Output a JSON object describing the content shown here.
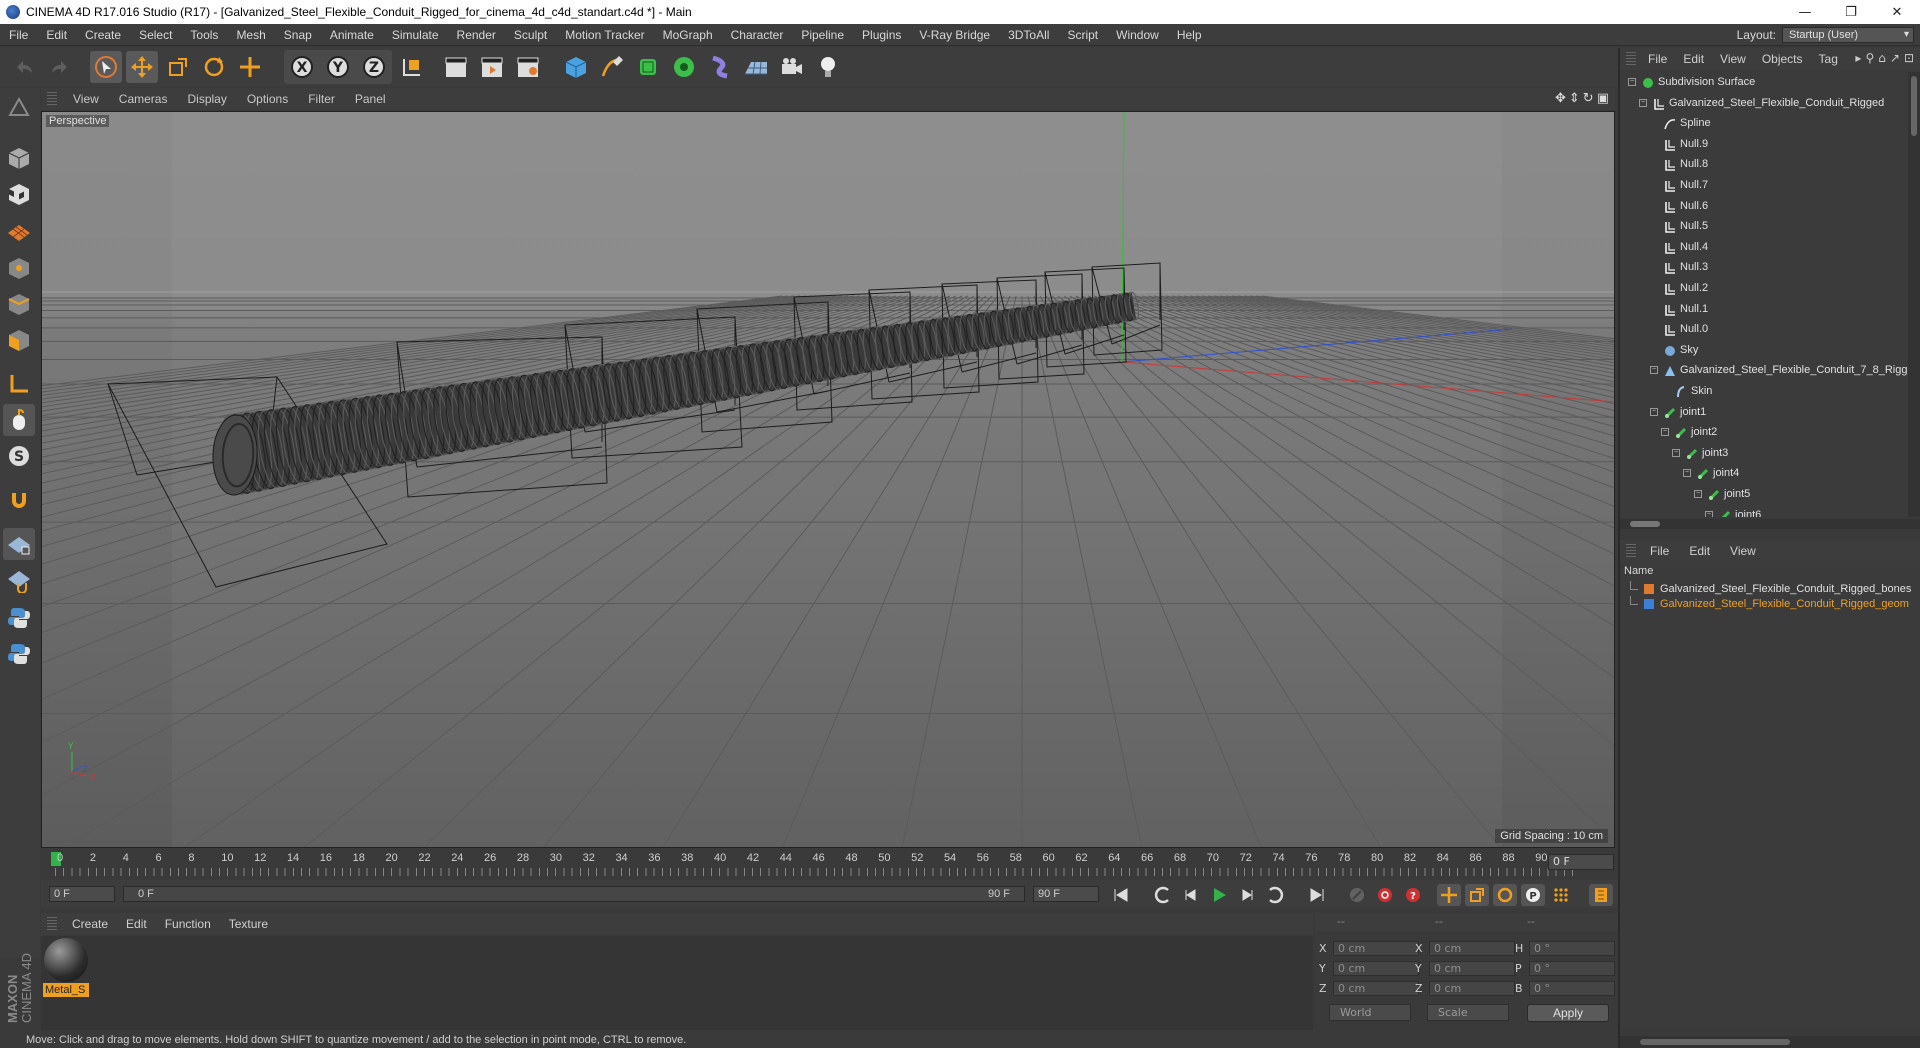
{
  "titlebar": {
    "title": "CINEMA 4D R17.016 Studio (R17) - [Galvanized_Steel_Flexible_Conduit_Rigged_for_cinema_4d_c4d_standart.c4d *] - Main",
    "minimize": "—",
    "restore": "❐",
    "close": "✕"
  },
  "menubar": {
    "items": [
      "File",
      "Edit",
      "Create",
      "Select",
      "Tools",
      "Mesh",
      "Snap",
      "Animate",
      "Simulate",
      "Render",
      "Sculpt",
      "Motion Tracker",
      "MoGraph",
      "Character",
      "Pipeline",
      "Plugins",
      "V-Ray Bridge",
      "3DToAll",
      "Script",
      "Window",
      "Help"
    ],
    "layout_label": "Layout:",
    "layout_value": "Startup (User)"
  },
  "viewport": {
    "menu": [
      "View",
      "Cameras",
      "Display",
      "Options",
      "Filter",
      "Panel"
    ],
    "label": "Perspective",
    "grid_spacing": "Grid Spacing : 10 cm",
    "axis_y": "Y",
    "axis_x": "X",
    "axis_z": "Z"
  },
  "timeline": {
    "ticks": [
      "0",
      "2",
      "4",
      "6",
      "8",
      "10",
      "12",
      "14",
      "16",
      "18",
      "20",
      "22",
      "24",
      "26",
      "28",
      "30",
      "32",
      "34",
      "36",
      "38",
      "40",
      "42",
      "44",
      "46",
      "48",
      "50",
      "52",
      "54",
      "56",
      "58",
      "60",
      "62",
      "64",
      "66",
      "68",
      "70",
      "72",
      "74",
      "76",
      "78",
      "80",
      "82",
      "84",
      "86",
      "88",
      "90"
    ],
    "current_frame": "0 F"
  },
  "transport": {
    "start_field": "0 F",
    "slider_start": "0 F",
    "slider_end": "90 F",
    "end_field": "90 F"
  },
  "material_panel": {
    "menu": [
      "Create",
      "Edit",
      "Function",
      "Texture"
    ],
    "material_name": "Metal_S",
    "brand": "MAXON",
    "brand2": "CINEMA 4D"
  },
  "coordinates": {
    "header": [
      "--",
      "--",
      "--"
    ],
    "rows": [
      {
        "axis1": "X",
        "v1": "0 cm",
        "axis2": "X",
        "v2": "0 cm",
        "axis3": "H",
        "v3": "0 °"
      },
      {
        "axis1": "Y",
        "v1": "0 cm",
        "axis2": "Y",
        "v2": "0 cm",
        "axis3": "P",
        "v3": "0 °"
      },
      {
        "axis1": "Z",
        "v1": "0 cm",
        "axis2": "Z",
        "v2": "0 cm",
        "axis3": "B",
        "v3": "0 °"
      }
    ],
    "space": "World",
    "mode": "Scale",
    "apply": "Apply"
  },
  "statusbar": {
    "text": "Move: Click and drag to move elements. Hold down SHIFT to quantize movement / add to the selection in point mode, CTRL to remove."
  },
  "objects_panel": {
    "menu": [
      "File",
      "Edit",
      "View",
      "Objects",
      "Tag"
    ],
    "items": [
      {
        "label": "Subdivision Surface",
        "indent": 0,
        "icon": "subdivision-icon",
        "expander": "−"
      },
      {
        "label": "Galvanized_Steel_Flexible_Conduit_Rigged",
        "indent": 1,
        "icon": "null-icon",
        "expander": "−"
      },
      {
        "label": "Spline",
        "indent": 2,
        "icon": "spline-icon",
        "expander": ""
      },
      {
        "label": "Null.9",
        "indent": 2,
        "icon": "null-icon",
        "expander": ""
      },
      {
        "label": "Null.8",
        "indent": 2,
        "icon": "null-icon",
        "expander": ""
      },
      {
        "label": "Null.7",
        "indent": 2,
        "icon": "null-icon",
        "expander": ""
      },
      {
        "label": "Null.6",
        "indent": 2,
        "icon": "null-icon",
        "expander": ""
      },
      {
        "label": "Null.5",
        "indent": 2,
        "icon": "null-icon",
        "expander": ""
      },
      {
        "label": "Null.4",
        "indent": 2,
        "icon": "null-icon",
        "expander": ""
      },
      {
        "label": "Null.3",
        "indent": 2,
        "icon": "null-icon",
        "expander": ""
      },
      {
        "label": "Null.2",
        "indent": 2,
        "icon": "null-icon",
        "expander": ""
      },
      {
        "label": "Null.1",
        "indent": 2,
        "icon": "null-icon",
        "expander": ""
      },
      {
        "label": "Null.0",
        "indent": 2,
        "icon": "null-icon",
        "expander": ""
      },
      {
        "label": "Sky",
        "indent": 2,
        "icon": "sky-icon",
        "expander": ""
      },
      {
        "label": "Galvanized_Steel_Flexible_Conduit_7_8_Rigg",
        "indent": 2,
        "icon": "polygon-icon",
        "expander": "−"
      },
      {
        "label": "Skin",
        "indent": 3,
        "icon": "skin-icon",
        "expander": ""
      },
      {
        "label": "joint1",
        "indent": 2,
        "icon": "joint-icon",
        "expander": "−"
      },
      {
        "label": "joint2",
        "indent": 3,
        "icon": "joint-icon",
        "expander": "−"
      },
      {
        "label": "joint3",
        "indent": 4,
        "icon": "joint-icon",
        "expander": "−"
      },
      {
        "label": "joint4",
        "indent": 5,
        "icon": "joint-icon",
        "expander": "−"
      },
      {
        "label": "joint5",
        "indent": 6,
        "icon": "joint-icon",
        "expander": "−"
      },
      {
        "label": "joint6",
        "indent": 7,
        "icon": "joint-icon",
        "expander": "−"
      }
    ]
  },
  "layers_panel": {
    "menu": [
      "File",
      "Edit",
      "View"
    ],
    "name_header": "Name",
    "rows": [
      {
        "label": "Galvanized_Steel_Flexible_Conduit_Rigged_bones",
        "color": "#e07a30",
        "text_color": "#e0e0e0"
      },
      {
        "label": "Galvanized_Steel_Flexible_Conduit_Rigged_geom",
        "color": "#3d7fd6",
        "text_color": "#f0a020"
      }
    ]
  },
  "colors": {
    "accent_orange": "#f0a020",
    "playhead_green": "#31b34a",
    "axis_red": "#c03030",
    "axis_green": "#30c030",
    "axis_blue": "#3050d0"
  }
}
